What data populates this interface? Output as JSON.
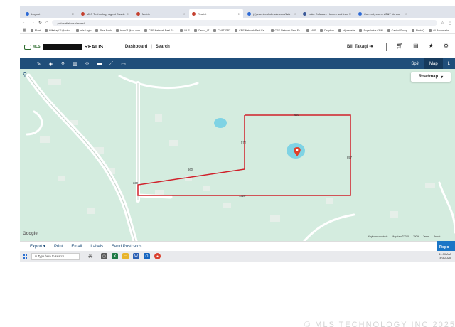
{
  "browser": {
    "tabs": [
      {
        "title": "Logout",
        "color": "#2d6ad6"
      },
      {
        "title": "MLS Technology Agent Dashb",
        "color": "#c4402f"
      },
      {
        "title": "Matrix",
        "color": "#c4402f"
      },
      {
        "title": "Realist",
        "color": "#c4402f",
        "active": true
      },
      {
        "title": "(s) eseniorsholesale.com/listin",
        "color": "#2d6ad6"
      },
      {
        "title": "Lake Eufaula - Homes and Lan",
        "color": "#3b5998"
      },
      {
        "title": "Currently.com - AT&T Yahoo",
        "color": "#2d6ad6"
      }
    ],
    "url": "prd.realist.com/search",
    "bookmarks": [
      "BMet",
      "billtakagi11@aol.c...",
      "mls Login",
      "Real Book",
      "bunn11@aol.com",
      "CRE Network Real Es...",
      "MLS",
      "Canva_IT",
      "CHAT GPT",
      "CRE Network Real Es...",
      "CRE Network Real Es...",
      "MLS",
      "Dropbox",
      "(d) website",
      "Superlative CRM",
      "Capitol Group",
      "PhotoQ",
      "All Bookmarks"
    ]
  },
  "app": {
    "brand": "REALIST",
    "nav": [
      "Dashboard",
      "Search"
    ],
    "nav_separator": "|",
    "user": "Bill Takagi",
    "logo_text": "MLS",
    "view_buttons": [
      "Split",
      "Map",
      "L"
    ],
    "toolbar_icons": [
      "pencil-icon",
      "layers-icon",
      "pin-icon",
      "chart-icon",
      "binoculars-icon",
      "car-icon",
      "ruler-icon",
      "comment-icon"
    ],
    "header_icons": [
      "cart-icon",
      "document-icon",
      "star-icon",
      "gear-icon"
    ]
  },
  "map": {
    "map_type": "Roadmap",
    "branding": "Google",
    "attribution": [
      "Keyboard shortcuts",
      "Map data ©2025",
      "200 ft",
      "Terms",
      "Report"
    ],
    "measurements": {
      "top": "660",
      "right": "857",
      "inner_vertical": "572",
      "middle": "660",
      "bottom": "1320",
      "left": "330"
    },
    "boundary_color": "#d0202a"
  },
  "actions": {
    "items": [
      "Export",
      "Print",
      "Email",
      "Labels",
      "Send Postcards"
    ],
    "report_label": "Repo"
  },
  "taskbar": {
    "search_placeholder": "Type here to search",
    "time": "11:00 AM",
    "date": "4/3/2025"
  },
  "watermark": "© MLS TECHNOLOGY INC 2025"
}
